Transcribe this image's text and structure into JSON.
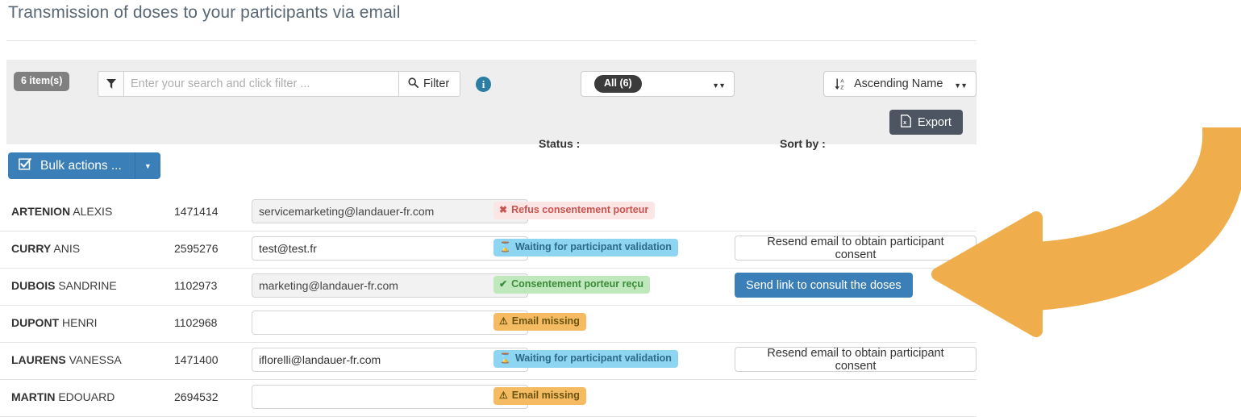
{
  "page": {
    "title": "Transmission of doses to your participants via email"
  },
  "toolbar": {
    "count_badge": "6 item(s)",
    "funnel_icon": "funnel-icon",
    "search_placeholder": "Enter your search and click filter ...",
    "search_value": "",
    "filter_label": "Filter",
    "filter_icon": "search-icon",
    "info_icon": "info-icon",
    "info_glyph": "i",
    "status_label": "Status :",
    "status_value": "All (6)",
    "sort_label": "Sort by :",
    "sort_value": "Ascending Name",
    "sort_icon": "sort-alpha-ascending-icon",
    "export_label": "Export",
    "export_icon": "excel-file-icon",
    "caret_glyph": "▼▼"
  },
  "bulk": {
    "label": "Bulk actions ...",
    "checkbox_icon": "checked-checkbox-icon",
    "caret_icon": "chevron-down-icon",
    "caret_glyph": "▼"
  },
  "colors": {
    "primary_blue": "#3a7fb8",
    "dark_slate": "#4c5561",
    "annotation_orange": "#efae4b",
    "badge_danger_bg": "#fbe5e5",
    "badge_danger_text": "#c9544f",
    "badge_info_bg": "#8ed5f2",
    "badge_info_text": "#2d6a8a",
    "badge_success_bg": "#bfe8bd",
    "badge_success_text": "#3c8a3a",
    "badge_warn_bg": "#f4bb63",
    "badge_warn_text": "#6b5410",
    "panel_grey": "#eeeeee",
    "count_badge_grey": "#808080"
  },
  "rows": [
    {
      "last_name": "ARTENION",
      "first_name": "ALEXIS",
      "id": "1471414",
      "email": "servicemarketing@landauer-fr.com",
      "email_disabled": true,
      "badge_text": "Refus consentement porteur",
      "badge_type": "danger",
      "badge_icon": "cross-icon",
      "badge_glyph": "✖",
      "action_label": "",
      "action_type": "none"
    },
    {
      "last_name": "CURRY",
      "first_name": "ANIS",
      "id": "2595276",
      "email": "test@test.fr",
      "email_disabled": false,
      "badge_text": "Waiting for participant validation",
      "badge_type": "info",
      "badge_icon": "hourglass-icon",
      "badge_glyph": "⌛",
      "action_label": "Resend email to obtain participant consent",
      "action_type": "outline"
    },
    {
      "last_name": "DUBOIS",
      "first_name": "SANDRINE",
      "id": "1102973",
      "email": "marketing@landauer-fr.com",
      "email_disabled": true,
      "badge_text": "Consentement porteur reçu",
      "badge_type": "success",
      "badge_icon": "check-icon",
      "badge_glyph": "✔",
      "action_label": "Send link to consult the doses",
      "action_type": "primary"
    },
    {
      "last_name": "DUPONT",
      "first_name": "HENRI",
      "id": "1102968",
      "email": "",
      "email_disabled": false,
      "badge_text": "Email missing",
      "badge_type": "warn",
      "badge_icon": "warning-triangle-icon",
      "badge_glyph": "⚠",
      "action_label": "",
      "action_type": "none"
    },
    {
      "last_name": "LAURENS",
      "first_name": "VANESSA",
      "id": "1471400",
      "email": "iflorelli@landauer-fr.com",
      "email_disabled": false,
      "badge_text": "Waiting for participant validation",
      "badge_type": "info",
      "badge_icon": "hourglass-icon",
      "badge_glyph": "⌛",
      "action_label": "Resend email to obtain participant consent",
      "action_type": "outline"
    },
    {
      "last_name": "MARTIN",
      "first_name": "EDOUARD",
      "id": "2694532",
      "email": "",
      "email_disabled": false,
      "badge_text": "Email missing",
      "badge_type": "warn",
      "badge_icon": "warning-triangle-icon",
      "badge_glyph": "⚠",
      "action_label": "",
      "action_type": "none"
    }
  ],
  "annotation": {
    "icon": "curved-arrow-left-icon"
  }
}
